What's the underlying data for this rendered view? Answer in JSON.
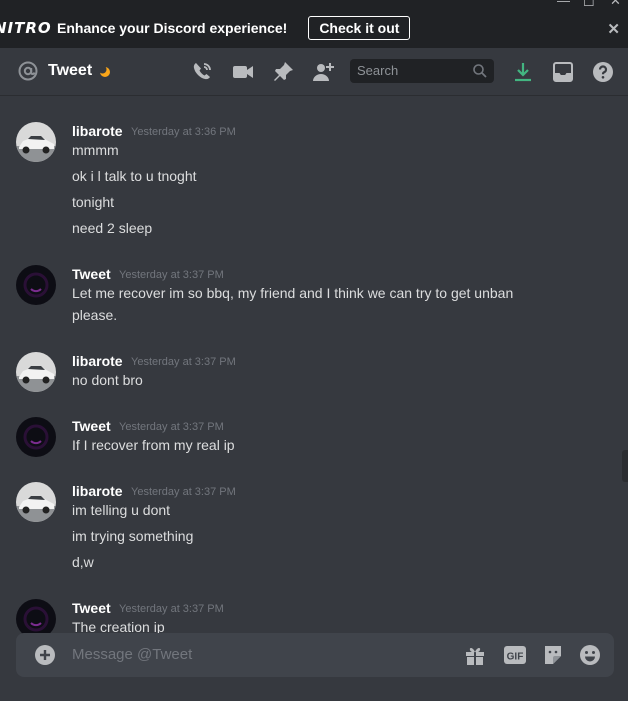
{
  "banner": {
    "logo": "NITRO",
    "text": "Enhance your Discord experience!",
    "button": "Check it out"
  },
  "header": {
    "channel_name": "Tweet",
    "search_placeholder": "Search"
  },
  "colors": {
    "background": "#36393f",
    "banner": "#202225",
    "download_accent": "#43b581",
    "moon": "#faa61a",
    "composer": "#40444b"
  },
  "messages": [
    {
      "user": "libarote",
      "timestamp": "Yesterday at 3:36 PM",
      "lines": [
        "mmmm",
        "ok i l talk to u tnoght",
        "tonight",
        "need 2 sleep"
      ]
    },
    {
      "user": "Tweet",
      "timestamp": "Yesterday at 3:37 PM",
      "lines": [
        "Let me recover im so bbq, my friend and I think we can try to get unban",
        "please."
      ]
    },
    {
      "user": "libarote",
      "timestamp": "Yesterday at 3:37 PM",
      "lines": [
        "no dont bro"
      ]
    },
    {
      "user": "Tweet",
      "timestamp": "Yesterday at 3:37 PM",
      "lines": [
        "If I recover from my real ip"
      ]
    },
    {
      "user": "libarote",
      "timestamp": "Yesterday at 3:37 PM",
      "lines": [
        "im telling u dont",
        "im trying something",
        "d,w"
      ]
    },
    {
      "user": "Tweet",
      "timestamp": "Yesterday at 3:37 PM",
      "lines": [
        "The creation ip"
      ]
    }
  ],
  "composer": {
    "placeholder": "Message @Tweet",
    "gif_label": "GIF"
  }
}
